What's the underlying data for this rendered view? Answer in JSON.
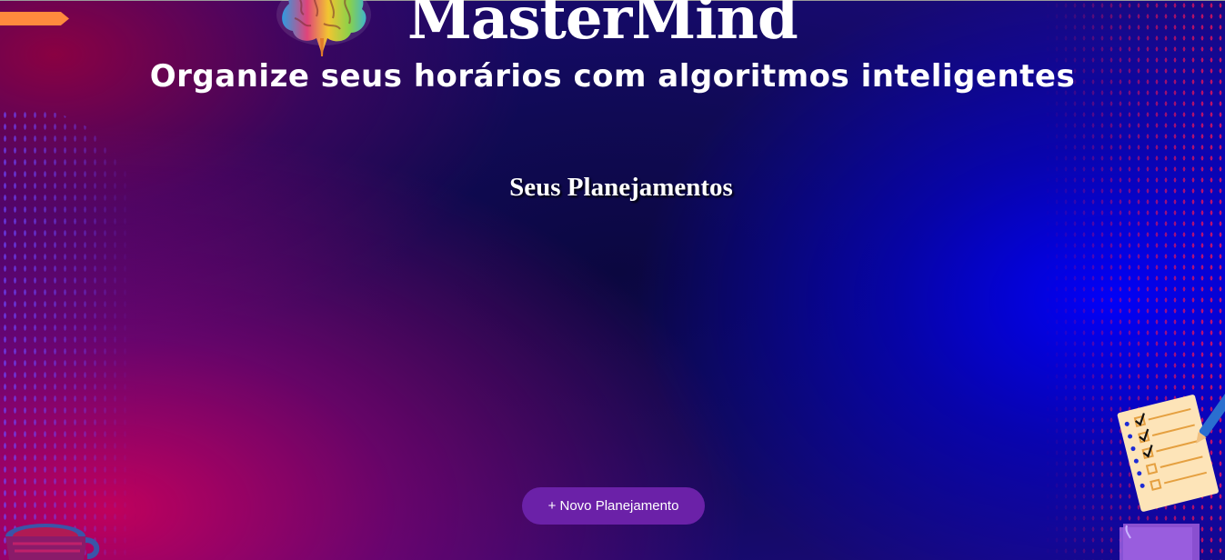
{
  "header": {
    "app_title": "MasterMind",
    "tagline": "Organize seus horários com algoritmos inteligentes"
  },
  "main": {
    "section_title": "Seus Planejamentos",
    "new_plan_button": "+ Novo Planejamento"
  },
  "decorations": {
    "logo": "brain-icon",
    "checklist": "checklist-illustration",
    "note": "purple-note-illustration",
    "cup": "coffee-cup-illustration"
  },
  "colors": {
    "button": "#6b21a8",
    "accent_orange": "#ff8a3d",
    "text": "#ffffff"
  }
}
